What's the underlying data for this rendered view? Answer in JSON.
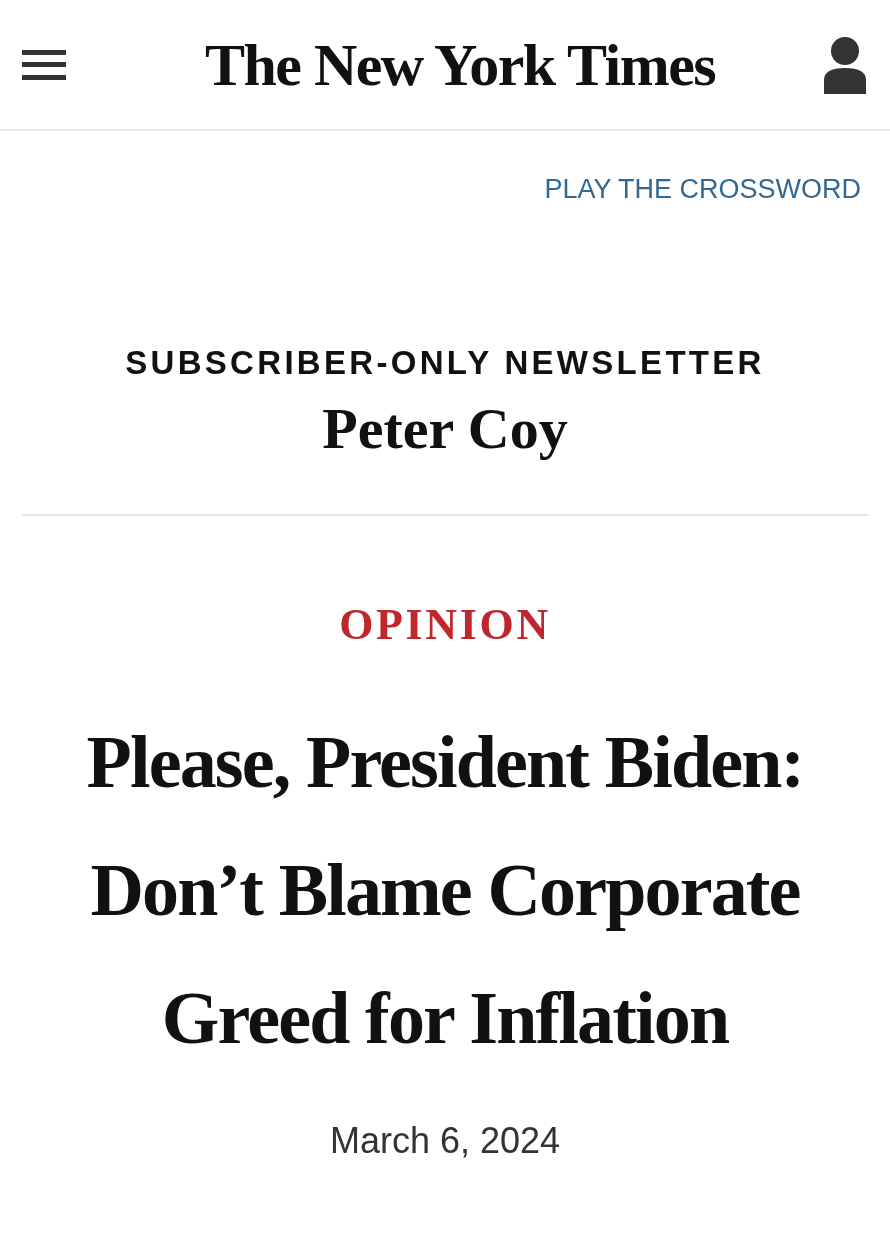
{
  "header": {
    "logo": "The New York Times"
  },
  "crossword_link": "PLAY THE CROSSWORD",
  "newsletter": {
    "label": "SUBSCRIBER-ONLY NEWSLETTER",
    "author": "Peter Coy"
  },
  "article": {
    "section": "OPINION",
    "headline": "Please, President Biden: Don’t Blame Corporate Greed for Inflation",
    "date": "March 6, 2024"
  }
}
